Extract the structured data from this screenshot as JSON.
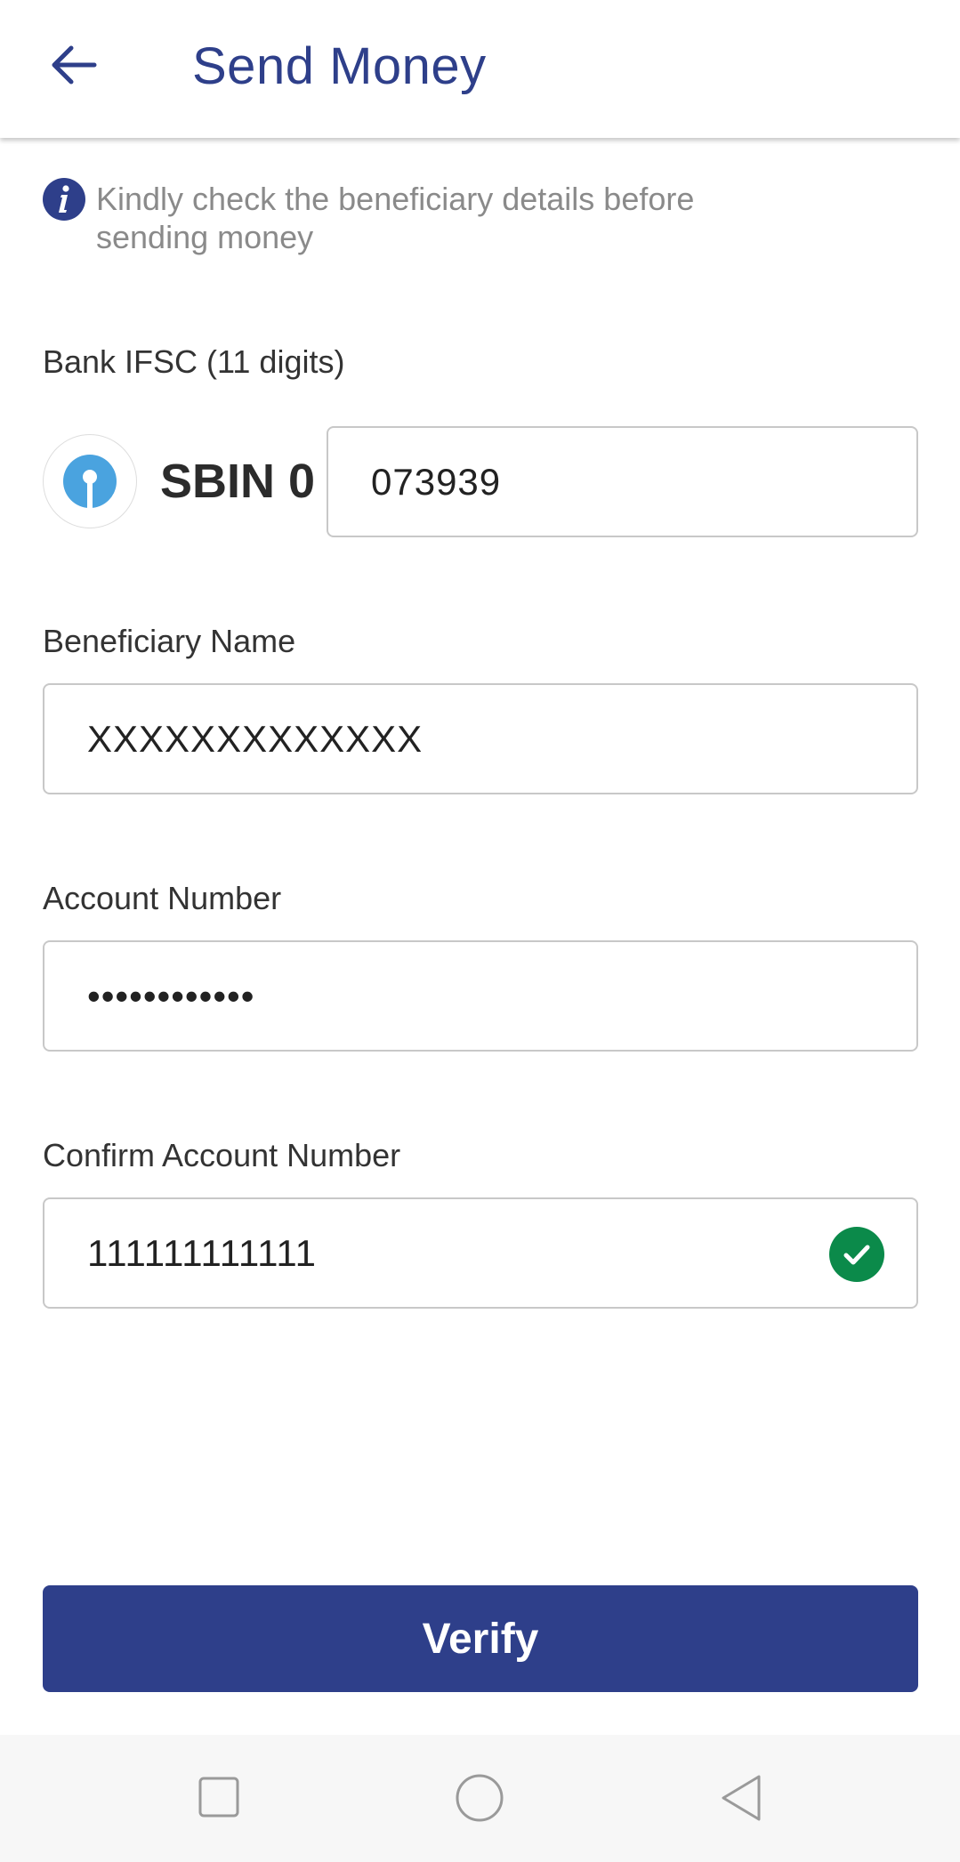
{
  "header": {
    "title": "Send Money",
    "back_icon": "arrow-left-icon"
  },
  "notice": {
    "icon": "info-icon",
    "text": "Kindly check the beneficiary details before sending money"
  },
  "ifsc": {
    "label": "Bank IFSC (11 digits)",
    "bank_logo_icon": "sbi-logo-icon",
    "prefix": "SBIN 0",
    "value": "073939"
  },
  "beneficiary": {
    "label": "Beneficiary Name",
    "value": "XXXXXXXXXXXXX"
  },
  "account": {
    "label": "Account Number",
    "value": "••••••••••••"
  },
  "confirm_account": {
    "label": "Confirm Account Number",
    "value": "111111111111",
    "status_icon": "check-circle-icon"
  },
  "verify_button": {
    "label": "Verify"
  },
  "system_nav": {
    "items": [
      "recents-icon",
      "home-icon",
      "back-triangle-icon"
    ]
  },
  "colors": {
    "primary": "#2e3f8a",
    "success": "#0b8a4a",
    "sbi_blue": "#4aa3df"
  }
}
